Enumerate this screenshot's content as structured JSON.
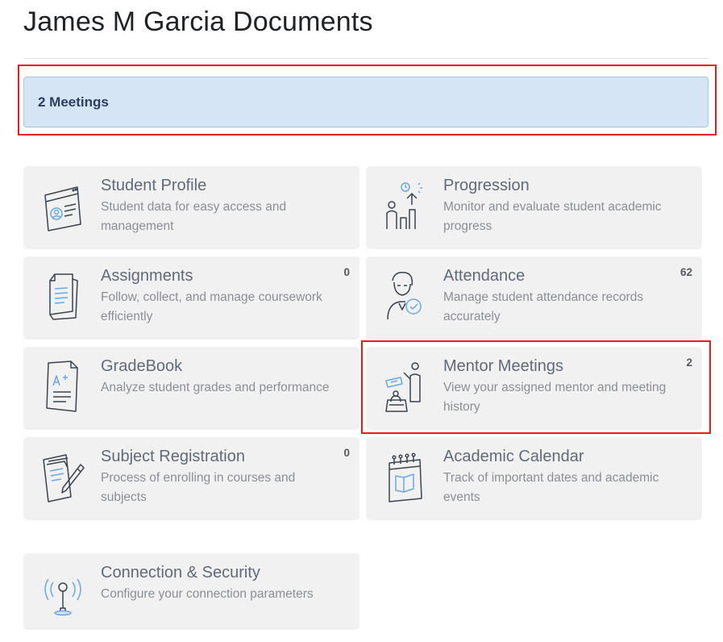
{
  "page": {
    "title": "James M Garcia Documents"
  },
  "banner": {
    "label": "2 Meetings"
  },
  "cards": {
    "student_profile": {
      "title": "Student Profile",
      "description": "Student data for easy access and management",
      "icon": "profile-browser-icon"
    },
    "progression": {
      "title": "Progression",
      "description": "Monitor and evaluate student academic progress",
      "icon": "progress-chart-icon"
    },
    "assignments": {
      "title": "Assignments",
      "description": "Follow, collect, and manage coursework efficiently",
      "count": "0",
      "icon": "documents-icon"
    },
    "attendance": {
      "title": "Attendance",
      "description": "Manage student attendance records accurately",
      "count": "62",
      "icon": "attendance-person-check-icon"
    },
    "gradebook": {
      "title": "GradeBook",
      "description": "Analyze student grades and performance",
      "icon": "grade-sheet-icon"
    },
    "mentor_meetings": {
      "title": "Mentor Meetings",
      "description": "View your assigned mentor and meeting history",
      "count": "2",
      "icon": "mentor-presentation-icon"
    },
    "subject_registration": {
      "title": "Subject Registration",
      "description": "Process of enrolling in courses and subjects",
      "count": "0",
      "icon": "registration-form-pen-icon"
    },
    "academic_calendar": {
      "title": "Academic Calendar",
      "description": "Track of important dates and academic events",
      "icon": "calendar-book-icon"
    },
    "connection_security": {
      "title": "Connection & Security",
      "description": "Configure your connection parameters",
      "icon": "broadcast-antenna-icon"
    }
  },
  "colors": {
    "highlight": "#e8191f",
    "banner_bg": "#d6e5f5",
    "card_bg": "#f1f1f1",
    "icon_stroke": "#3a4450",
    "accent_blue": "#6aa8e0"
  }
}
